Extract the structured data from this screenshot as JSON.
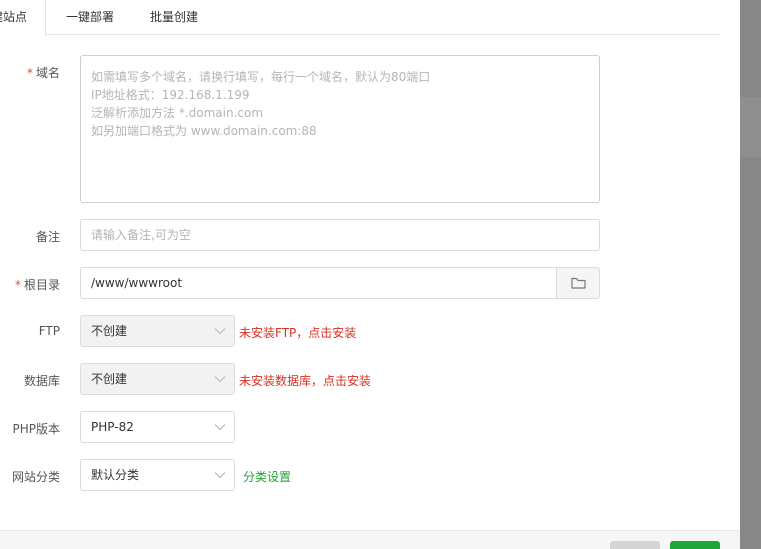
{
  "tabs": [
    {
      "label": "建站点",
      "active": true
    },
    {
      "label": "一键部署"
    },
    {
      "label": "批量创建"
    }
  ],
  "form": {
    "domain": {
      "label": "域名",
      "required": "*",
      "placeholder_lines": [
        "如需填写多个域名，请换行填写，每行一个域名，默认为80端口",
        "IP地址格式：192.168.1.199",
        "泛解析添加方法 *.domain.com",
        "如另加端口格式为 www.domain.com:88"
      ]
    },
    "remark": {
      "label": "备注",
      "placeholder": "请输入备注,可为空"
    },
    "root": {
      "label": "根目录",
      "required": "*",
      "value": "/www/wwwroot"
    },
    "ftp": {
      "label": "FTP",
      "selected": "不创建",
      "warning": "未安装FTP，点击安装"
    },
    "database": {
      "label": "数据库",
      "selected": "不创建",
      "warning": "未安装数据库，点击安装"
    },
    "php": {
      "label": "PHP版本",
      "selected": "PHP-82"
    },
    "category": {
      "label": "网站分类",
      "selected": "默认分类",
      "link": "分类设置"
    }
  },
  "colors": {
    "accent_green": "#20a53a",
    "warning_red": "#d9301f",
    "required_red": "#e74c3c"
  },
  "icons": {
    "folder": "folder-icon",
    "chevron": "chevron-down-icon"
  }
}
